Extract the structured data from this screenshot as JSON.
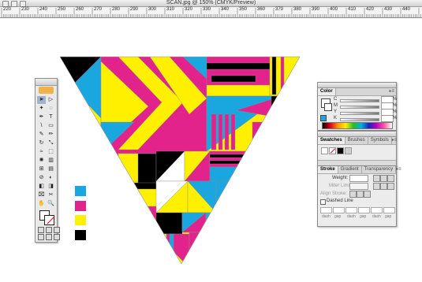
{
  "window": {
    "title": "SCAN.jpg @ 150% (CMYK/Preview)"
  },
  "ruler": {
    "labels": [
      "220",
      "230",
      "240",
      "250",
      "260",
      "270",
      "280",
      "290",
      "300",
      "310",
      "320",
      "330",
      "340",
      "350",
      "360",
      "370",
      "380",
      "390",
      "400",
      "410",
      "420",
      "430",
      "440"
    ]
  },
  "color_chips": [
    {
      "name": "cyan",
      "color": "#1aa7e0"
    },
    {
      "name": "magenta",
      "color": "#e3238c"
    },
    {
      "name": "yellow",
      "color": "#fff000"
    },
    {
      "name": "black",
      "color": "#000000"
    }
  ],
  "palette": {
    "cyan": "#1aa7e0",
    "magenta": "#e3238c",
    "yellow": "#fff000",
    "black": "#000000",
    "white": "#ffffff"
  },
  "tools": [
    "selection-tool",
    "direct-selection-tool",
    "magic-wand-tool",
    "lasso-tool",
    "pen-tool",
    "type-tool",
    "line-segment-tool",
    "rectangle-tool",
    "paintbrush-tool",
    "pencil-tool",
    "rotate-tool",
    "scale-tool",
    "warp-tool",
    "free-transform-tool",
    "symbol-sprayer-tool",
    "column-graph-tool",
    "mesh-tool",
    "gradient-tool",
    "eyedropper-tool",
    "blend-tool",
    "live-paint-tool",
    "live-paint-selection-tool",
    "slice-tool",
    "scissors-tool",
    "hand-tool",
    "zoom-tool"
  ],
  "tool_glyphs": [
    "➤",
    "▷",
    "✦",
    "◌",
    "✒",
    "T",
    "\\",
    "▭",
    "✎",
    "✏",
    "↻",
    "⤡",
    "≈",
    "⬚",
    "✺",
    "▥",
    "⊞",
    "▤",
    "⊘",
    "◐",
    "◧",
    "◨",
    "⌧",
    "✂",
    "✋",
    "🔍"
  ],
  "color_panel": {
    "tab": "Color",
    "sliders": [
      {
        "letter": "C",
        "value": "",
        "unit": "%"
      },
      {
        "letter": "M",
        "value": "",
        "unit": "%"
      },
      {
        "letter": "Y",
        "value": "",
        "unit": "%"
      },
      {
        "letter": "K",
        "value": "",
        "unit": "%"
      }
    ]
  },
  "swatches_panel": {
    "tabs": [
      "Swatches",
      "Brushes",
      "Symbols"
    ]
  },
  "stroke_panel": {
    "tabs": [
      "Stroke",
      "Gradient",
      "Transparency"
    ],
    "weight_label": "Weight:",
    "miter_label": "Miter Limit:",
    "align_label": "Align Stroke:",
    "dashed_label": "Dashed Line",
    "dash_labels": [
      "dash",
      "gap",
      "dash",
      "gap",
      "dash",
      "gap"
    ]
  }
}
